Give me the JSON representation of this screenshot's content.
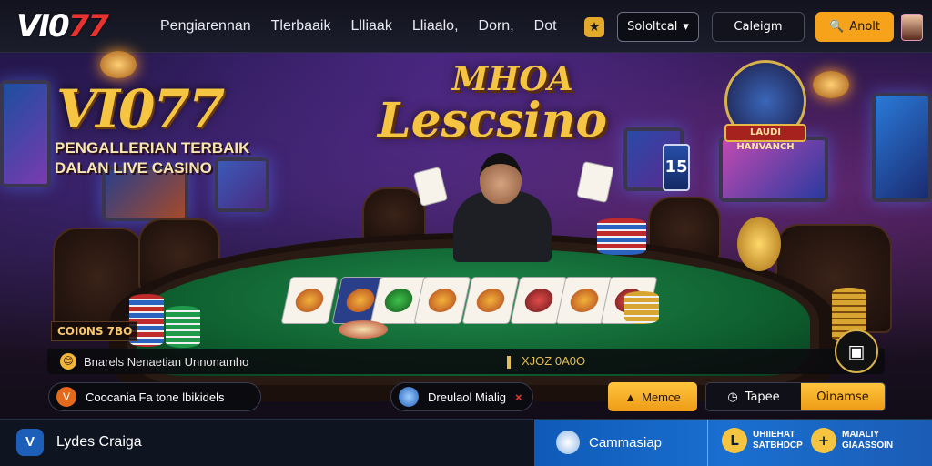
{
  "header": {
    "logo_left": "VI0",
    "logo_right": "77",
    "nav": [
      "Pengiarennan",
      "Tlerbaaik",
      "Llliaak",
      "Lliaalo,",
      "Dorn,",
      "Dot"
    ],
    "select_label": "Sololtcal",
    "select_arrow": "▾",
    "login_label": "Caleigm",
    "search_label": "Anolt",
    "search_icon": "🔍"
  },
  "hero": {
    "logo": "VI077",
    "tagline_line1": "PENGALLERIAN TERBAIK",
    "tagline_line2": "DALAN LIVE CASINO",
    "casino_title_1": "MHOA",
    "casino_title_2": "Lescsino",
    "host_badge": "LAUDI HANVANCH",
    "table_number": "15",
    "chip_info": "COI0NS 7BO"
  },
  "info_bar": {
    "icon": "😊",
    "text": "Bnarels Nenaetian Unnonamho",
    "code": "XJOZ 0A0O"
  },
  "actions": {
    "pill_left_icon": "V",
    "pill_left": "Coocania  Fa tone lbikidels",
    "pill_mid": "Dreulaol Mialig",
    "pill_mid_close": "×",
    "btn_home": "Memce",
    "combo_left": "Tapee",
    "combo_right": "Oinamse"
  },
  "footer": {
    "brand_icon": "V",
    "brand": "Lydes Craiga",
    "campaign": "Cammasiap",
    "badge1_icon": "L",
    "badge1_line1": "UHIIEHAT",
    "badge1_line2": "SATBHDCP",
    "badge2_icon": "+",
    "badge2_line1": "MAIALIY",
    "badge2_line2": "GIAASSOIN"
  },
  "colors": {
    "accent": "#f6a31b",
    "gold": "#f5c542",
    "brand_red": "#e8322f",
    "footer_blue": "#1a6fd0"
  }
}
